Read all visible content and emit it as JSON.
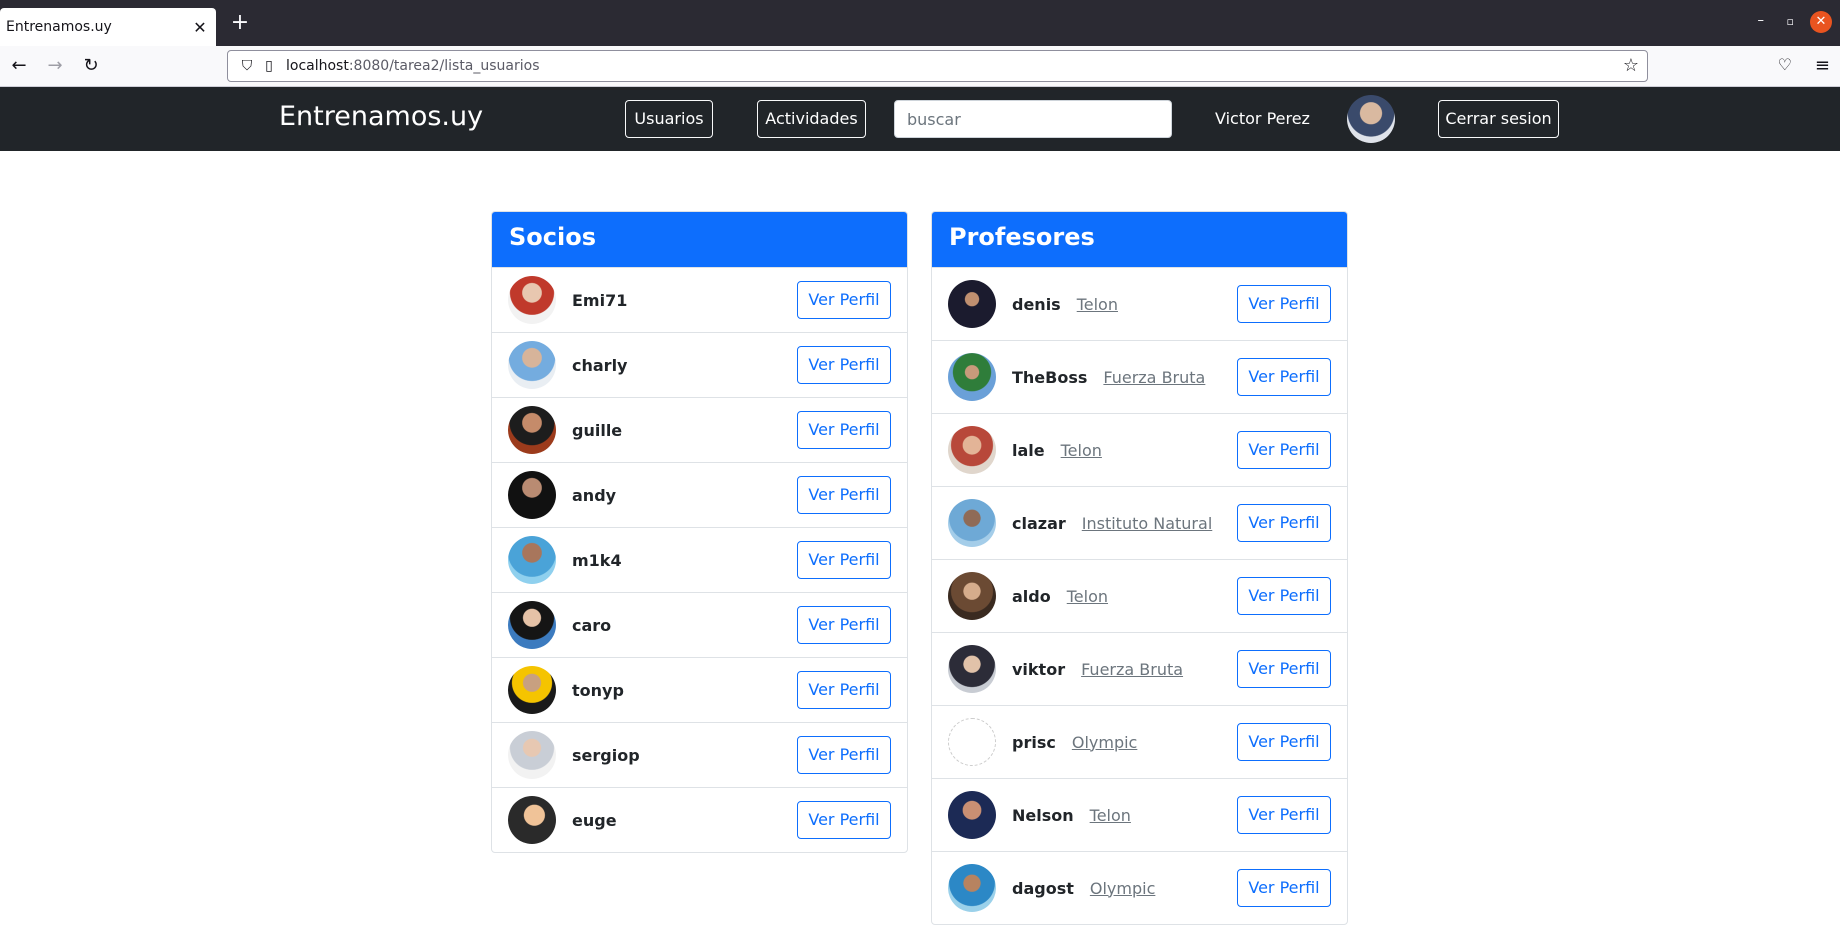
{
  "browser": {
    "tab_title": "Entrenamos.uy",
    "url_host": "localhost",
    "url_path": ":8080/tarea2/lista_usuarios"
  },
  "header": {
    "brand": "Entrenamos.uy",
    "usuarios_label": "Usuarios",
    "actividades_label": "Actividades",
    "search_placeholder": "buscar",
    "user_name": "Victor Perez",
    "logout_label": "Cerrar sesion"
  },
  "socios": {
    "title": "Socios",
    "button_label": "Ver Perfil",
    "items": [
      {
        "nickname": "Emi71"
      },
      {
        "nickname": "charly"
      },
      {
        "nickname": "guille"
      },
      {
        "nickname": "andy"
      },
      {
        "nickname": "m1k4"
      },
      {
        "nickname": "caro"
      },
      {
        "nickname": "tonyp"
      },
      {
        "nickname": "sergiop"
      },
      {
        "nickname": "euge"
      }
    ]
  },
  "profesores": {
    "title": "Profesores",
    "button_label": "Ver Perfil",
    "items": [
      {
        "nickname": "denis",
        "institution": "Telon"
      },
      {
        "nickname": "TheBoss",
        "institution": "Fuerza Bruta"
      },
      {
        "nickname": "lale",
        "institution": "Telon"
      },
      {
        "nickname": "clazar",
        "institution": "Instituto Natural"
      },
      {
        "nickname": "aldo",
        "institution": "Telon"
      },
      {
        "nickname": "viktor",
        "institution": "Fuerza Bruta"
      },
      {
        "nickname": "prisc",
        "institution": "Olympic"
      },
      {
        "nickname": "Nelson",
        "institution": "Telon"
      },
      {
        "nickname": "dagost",
        "institution": "Olympic"
      }
    ]
  },
  "colors": {
    "header_bg": "#212529",
    "panel_header": "#0d6efd",
    "link_muted": "#6c757d"
  }
}
